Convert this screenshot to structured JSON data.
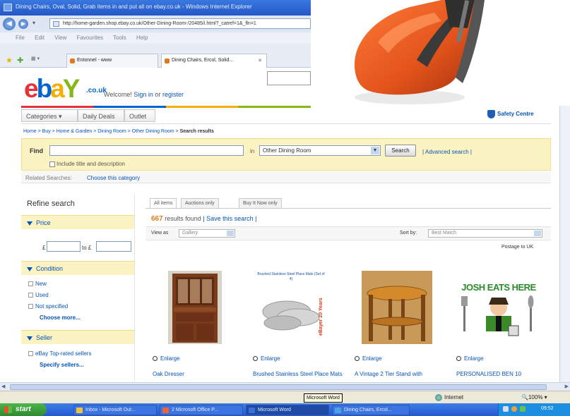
{
  "browser": {
    "window_title": "Dining Chairs, Oval, Solid, Grab items in and put all on ebay.co.uk - Windows Internet Explorer",
    "address": "http://home-garden.shop.ebay.co.uk/Other-Dining-Room-/20485/i.html?_catref=1&_fln=1",
    "menu": [
      "File",
      "Edit",
      "View",
      "Favourites",
      "Tools",
      "Help"
    ],
    "tabs": [
      {
        "label": "Entonnel - www"
      },
      {
        "label": "Dining Chairs, Ercol, Solid...",
        "active": true
      }
    ]
  },
  "header": {
    "logo": {
      "e": "e",
      "b": "b",
      "a": "a",
      "y": "Y",
      "suffix": ".co.uk"
    },
    "welcome": "Welcome!",
    "signin": "Sign in",
    "or": "or",
    "register": "register",
    "menu": [
      "Categories ▾",
      "Daily Deals",
      "Outlet"
    ],
    "safety_centre": "Safety Centre"
  },
  "breadcrumb": {
    "path": "Home > Buy > Home & Garden > Dining Room > Other Dining Room >",
    "current": "Search results"
  },
  "find": {
    "label": "Find",
    "in_label": "in",
    "category": "Other Dining Room",
    "search_button": "Search",
    "advanced": "| Advanced search |",
    "include_title": "Include title and description",
    "related_label": "Related Searches:",
    "related_link": "Choose this category"
  },
  "refine": {
    "title": "Refine search",
    "price": {
      "label": "Price",
      "from_prefix": "£",
      "to_prefix": "to £"
    },
    "condition": {
      "label": "Condition",
      "items": [
        "New",
        "Used",
        "Not specified"
      ],
      "more": "Choose more..."
    },
    "seller": {
      "label": "Seller",
      "items": [
        "eBay Top-rated sellers"
      ],
      "more": "Specify sellers..."
    }
  },
  "results": {
    "tabs": [
      "All items",
      "Auctions only",
      "Buy It Now only"
    ],
    "count": "667",
    "count_suffix": "results found",
    "save_search": "| Save this search |",
    "view_as_label": "View as",
    "view_as_value": "Gallery",
    "sort_label": "Sort by:",
    "sort_value": "Best Match",
    "postage_label": "Postage to UK"
  },
  "listings": [
    {
      "enlarge": "Enlarge",
      "title": "Oak Dresser",
      "thumb": "oak-dresser"
    },
    {
      "enlarge": "Enlarge",
      "title": "Brushed Stainless Steel Place Mats",
      "thumb": "place-mats",
      "thumb_caption": "Brushed Stainless Steel Place Mats (Set of 4)",
      "thumb_side_text": "eBayer 20 Years"
    },
    {
      "enlarge": "Enlarge",
      "title": "A Vintage 2 Tier Stand with",
      "thumb": "tier-stand"
    },
    {
      "enlarge": "Enlarge",
      "title": "PERSONALISED BEN 10",
      "thumb": "ben10-sign",
      "thumb_caption": "JOSH EATS HERE"
    }
  ],
  "statusbar": {
    "tooltip": "Microsoft Word",
    "zone": "Internet",
    "zoom": "100%"
  },
  "taskbar": {
    "start": "start",
    "tasks": [
      {
        "label": "Inbox - Microsoft Out...",
        "color": "#f0c040"
      },
      {
        "label": "2 Microsoft Office P...",
        "color": "#e8663a"
      },
      {
        "label": "Microsoft Word",
        "color": "#3a6fd8",
        "active": true
      },
      {
        "label": "Dining Chairs, Ercol...",
        "color": "#4aa3e8"
      }
    ],
    "clock": "09:52"
  },
  "colors": {
    "ebay_red": "#e53238",
    "ebay_blue": "#0064d2",
    "ebay_yellow": "#f5af02",
    "ebay_green": "#86b817",
    "link": "#0654ba",
    "findbar": "#fcf3c2",
    "count_orange": "#e07a1f"
  }
}
